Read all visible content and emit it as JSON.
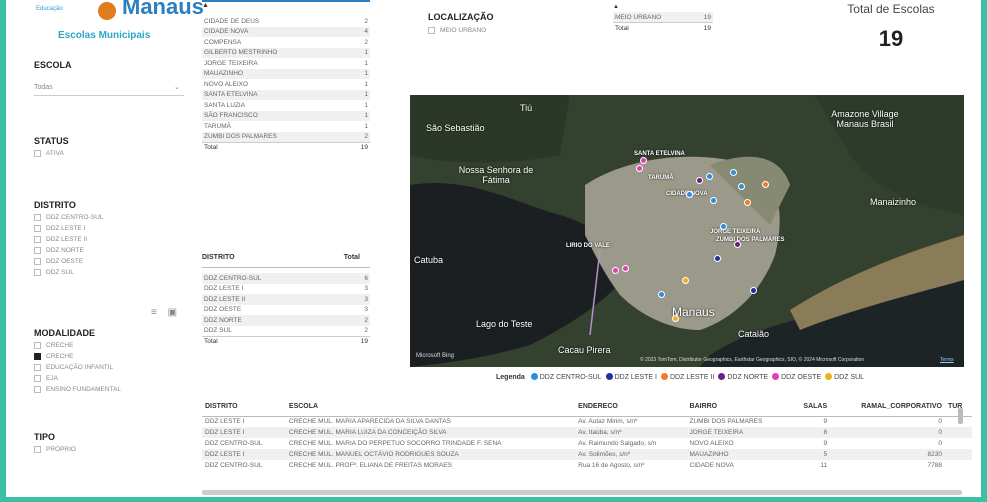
{
  "logo": {
    "small": "Educação",
    "name": "Manaus",
    "subtitle": "Escolas Municipais"
  },
  "slicers": {
    "escola": {
      "label": "ESCOLA",
      "value": "Todas"
    },
    "status": {
      "label": "STATUS",
      "items": [
        "ATIVA"
      ]
    },
    "distrito": {
      "label": "DISTRITO",
      "items": [
        "DDZ CENTRO-SUL",
        "DDZ LESTE I",
        "DDZ LESTE II",
        "DDZ NORTE",
        "DDZ OESTE",
        "DDZ SUL"
      ]
    },
    "modalidade": {
      "label": "MODALIDADE",
      "items": [
        "CRECHE",
        "CRECHE",
        "EDUCAÇÃO INFANTIL",
        "EJA",
        "ENSINO FUNDAMENTAL"
      ],
      "checked_index": 1
    },
    "tipo": {
      "label": "TIPO",
      "items": [
        "PRÓPRIO"
      ]
    },
    "localizacao": {
      "label": "LOCALIZAÇÃO",
      "items": [
        "MEIO URBANO"
      ]
    }
  },
  "bairro_table": {
    "rows": [
      [
        "CIDADE DE DEUS",
        "2"
      ],
      [
        "CIDADE NOVA",
        "4"
      ],
      [
        "COMPENSA",
        "2"
      ],
      [
        "GILBERTO MESTRINHO",
        "1"
      ],
      [
        "JORGE TEIXEIRA",
        "1"
      ],
      [
        "MAUAZINHO",
        "1"
      ],
      [
        "NOVO ALEIXO",
        "1"
      ],
      [
        "SANTA ETELVINA",
        "1"
      ],
      [
        "SANTA LUZIA",
        "1"
      ],
      [
        "SÃO FRANCISCO",
        "1"
      ],
      [
        "TARUMÃ",
        "1"
      ],
      [
        "ZUMBI DOS PALMARES",
        "2"
      ]
    ],
    "total_label": "Total",
    "total": "19"
  },
  "distrito_table": {
    "header": [
      "DISTRITO",
      "Total"
    ],
    "rows": [
      [
        "DDZ CENTRO-SUL",
        "6"
      ],
      [
        "DDZ LESTE I",
        "3"
      ],
      [
        "DDZ LESTE II",
        "3"
      ],
      [
        "DDZ OESTE",
        "3"
      ],
      [
        "DDZ NORTE",
        "2"
      ],
      [
        "DDZ SUL",
        "2"
      ]
    ],
    "total_label": "Total",
    "total": "19"
  },
  "loc_table": {
    "rows": [
      [
        "MEIO URBANO",
        "19"
      ]
    ],
    "total_label": "Total",
    "total": "19"
  },
  "kpi": {
    "title": "Total de Escolas",
    "value": "19"
  },
  "map": {
    "labels": [
      "São Sebastião",
      "Nossa Senhora de Fátima",
      "Tiú",
      "Amazone Village Manaus Brasil",
      "Manaizinho",
      "Catuba",
      "Lago do Teste",
      "Manaus",
      "Catalão",
      "Cacau Pirera"
    ],
    "tiny_labels": [
      "SANTA ETELVINA",
      "CIDADE NOVA",
      "TARUMÃ",
      "LIRIO DO VALE",
      "JORGE TEIXEIRA",
      "ZUMBI DOS PALMARES"
    ],
    "attribution": "© 2023 TomTom, Distributor Geographics, Earthstar Geographics, SIO, © 2024 Microsoft Corporation",
    "terms": "Terms",
    "bing": "Microsoft Bing"
  },
  "legend": {
    "title": "Legenda",
    "items": [
      {
        "label": "DDZ CENTRO-SUL",
        "color": "#2a8fe0"
      },
      {
        "label": "DDZ LESTE I",
        "color": "#1f2fa0"
      },
      {
        "label": "DDZ LESTE II",
        "color": "#f07a2a"
      },
      {
        "label": "DDZ NORTE",
        "color": "#6a1f8a"
      },
      {
        "label": "DDZ OESTE",
        "color": "#e040b0"
      },
      {
        "label": "DDZ SUL",
        "color": "#f0b020"
      }
    ]
  },
  "schools_table": {
    "headers": [
      "DISTRITO",
      "ESCOLA",
      "ENDERECO",
      "BAIRRO",
      "SALAS",
      "RAMAL_CORPORATIVO",
      "TUR"
    ],
    "rows": [
      [
        "DDZ LESTE I",
        "CRECHE MUL. MARIA APARECIDA DA SILVA DANTAS",
        "Av. Autaz Mirim, s/nº",
        "ZUMBI DOS PALMARES",
        "9",
        "0"
      ],
      [
        "DDZ LESTE I",
        "CRECHE MUL. MARIA LUIZA DA CONCEIÇÃO SILVA",
        "Av. Itaúba, s/nº",
        "JORGE TEIXEIRA",
        "8",
        "0"
      ],
      [
        "DDZ CENTRO-SUL",
        "CRECHE MUL. MARIA DO PERPETUO SOCORRO TRINDADE F. SENA",
        "Av. Raimundo Salgado, s/n",
        "NOVO ALEIXO",
        "9",
        "0"
      ],
      [
        "DDZ LESTE I",
        "CRECHE MUL. MANUEL OCTÁVIO RODRIGUES SOUZA",
        "Av. Solimões, s/nº",
        "MAUAZINHO",
        "5",
        "8230"
      ],
      [
        "DDZ CENTRO-SUL",
        "CRECHE MUL. PROFª. ELIANA DE FREITAS MORAES",
        "Rua 16 de Agosto, s/nº",
        "CIDADE NOVA",
        "11",
        "7788"
      ]
    ]
  }
}
